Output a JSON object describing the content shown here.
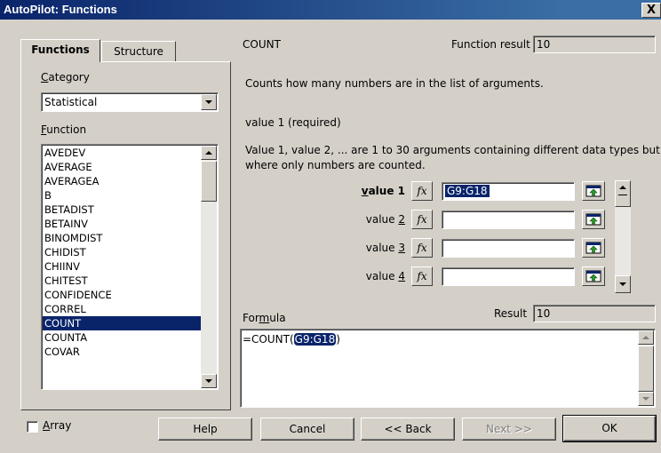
{
  "window": {
    "title": "AutoPilot: Functions",
    "close_glyph": "X"
  },
  "tabs": [
    {
      "label": "Functions",
      "active": true
    },
    {
      "label": "Structure",
      "active": false
    }
  ],
  "category": {
    "label": "Category",
    "value": "Statistical"
  },
  "function_list": {
    "label": "Function",
    "items": [
      "AVEDEV",
      "AVERAGE",
      "AVERAGEA",
      "B",
      "BETADIST",
      "BETAINV",
      "BINOMDIST",
      "CHIDIST",
      "CHIINV",
      "CHITEST",
      "CONFIDENCE",
      "CORREL",
      "COUNT",
      "COUNTA",
      "COVAR"
    ],
    "selected": "COUNT"
  },
  "function": {
    "name": "COUNT",
    "result_label": "Function result",
    "result_value": "10",
    "description": "Counts how many numbers are in the list of arguments.",
    "arg_heading": "value 1 (required)",
    "arg_description_line1": "Value 1, value 2, ... are 1 to 30 arguments containing different data types but",
    "arg_description_line2": "where only numbers are counted."
  },
  "arguments": [
    {
      "label_prefix": "",
      "label_accel": "v",
      "label_rest": "alue 1",
      "value": "G9:G18",
      "bold": true
    },
    {
      "label_prefix": "value ",
      "label_accel": "2",
      "label_rest": "",
      "value": ""
    },
    {
      "label_prefix": "value ",
      "label_accel": "3",
      "label_rest": "",
      "value": ""
    },
    {
      "label_prefix": "value ",
      "label_accel": "4",
      "label_rest": "",
      "value": ""
    }
  ],
  "fx_glyph": "fx",
  "formula": {
    "label": "Formula",
    "result_label": "Result",
    "result_value": "10",
    "text_prefix": "=COUNT(",
    "text_highlight": "G9:G18",
    "text_suffix": ")"
  },
  "array_checkbox": {
    "label": "Array",
    "checked": false
  },
  "buttons": {
    "help": "Help",
    "cancel": "Cancel",
    "back": "<< Back",
    "next": "Next >>",
    "ok": "OK"
  }
}
